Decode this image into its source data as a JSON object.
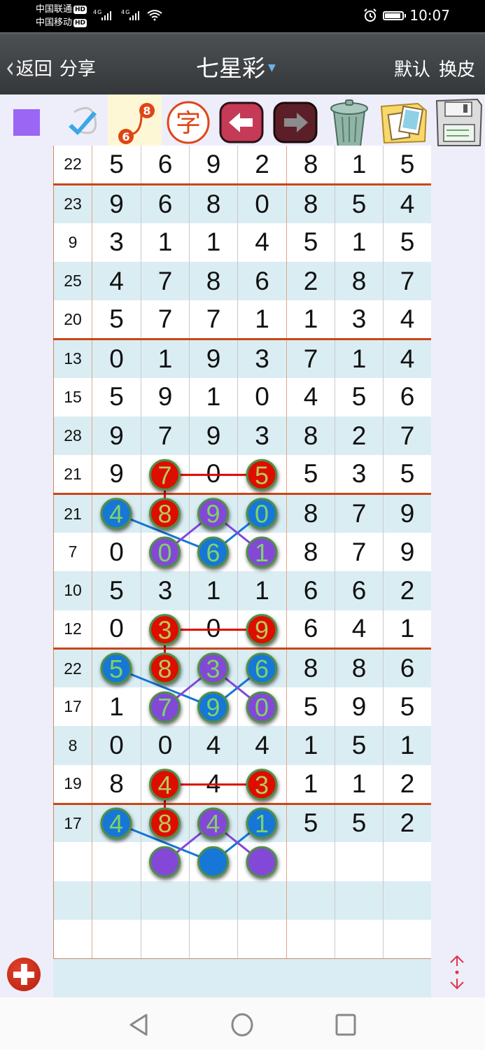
{
  "status_bar": {
    "carrier1": "中国联通",
    "carrier2": "中国移动",
    "hd_badge": "HD",
    "signal1": "4G",
    "signal2": "4G",
    "time": "10:07",
    "icons": [
      "alarm-icon",
      "battery-icon",
      "wifi-icon",
      "signal-icon"
    ]
  },
  "navbar": {
    "back_label": "返回",
    "share_label": "分享",
    "title": "七星彩",
    "default_label": "默认",
    "skin_label": "换皮"
  },
  "toolbar": {
    "items": [
      {
        "name": "color-swatch",
        "color": "#9b66f4"
      },
      {
        "name": "check-icon"
      },
      {
        "name": "connect-numbers-icon",
        "top_num": "8",
        "bottom_num": "6",
        "selected": true
      },
      {
        "name": "text-icon",
        "label": "字"
      },
      {
        "name": "undo-arrow-icon"
      },
      {
        "name": "redo-arrow-icon"
      },
      {
        "name": "trash-icon"
      },
      {
        "name": "photos-icon"
      },
      {
        "name": "save-icon"
      }
    ]
  },
  "grid": {
    "rows": [
      {
        "idx": "22",
        "nums": [
          "5",
          "6",
          "9",
          "2",
          "8",
          "1",
          "5"
        ],
        "sep": true
      },
      {
        "idx": "23",
        "nums": [
          "9",
          "6",
          "8",
          "0",
          "8",
          "5",
          "4"
        ]
      },
      {
        "idx": "9",
        "nums": [
          "3",
          "1",
          "1",
          "4",
          "5",
          "1",
          "5"
        ]
      },
      {
        "idx": "25",
        "nums": [
          "4",
          "7",
          "8",
          "6",
          "2",
          "8",
          "7"
        ]
      },
      {
        "idx": "20",
        "nums": [
          "5",
          "7",
          "7",
          "1",
          "1",
          "3",
          "4"
        ],
        "sep": true
      },
      {
        "idx": "13",
        "nums": [
          "0",
          "1",
          "9",
          "3",
          "7",
          "1",
          "4"
        ]
      },
      {
        "idx": "15",
        "nums": [
          "5",
          "9",
          "1",
          "0",
          "4",
          "5",
          "6"
        ]
      },
      {
        "idx": "28",
        "nums": [
          "9",
          "7",
          "9",
          "3",
          "8",
          "2",
          "7"
        ]
      },
      {
        "idx": "21",
        "nums": [
          "9",
          "7",
          "0",
          "5",
          "5",
          "3",
          "5"
        ],
        "sep": true
      },
      {
        "idx": "21",
        "nums": [
          "4",
          "8",
          "9",
          "0",
          "8",
          "7",
          "9"
        ]
      },
      {
        "idx": "7",
        "nums": [
          "0",
          "0",
          "6",
          "1",
          "8",
          "7",
          "9"
        ]
      },
      {
        "idx": "10",
        "nums": [
          "5",
          "3",
          "1",
          "1",
          "6",
          "6",
          "2"
        ]
      },
      {
        "idx": "12",
        "nums": [
          "0",
          "3",
          "0",
          "9",
          "6",
          "4",
          "1"
        ],
        "sep": true
      },
      {
        "idx": "22",
        "nums": [
          "5",
          "8",
          "3",
          "6",
          "8",
          "8",
          "6"
        ]
      },
      {
        "idx": "17",
        "nums": [
          "1",
          "7",
          "9",
          "0",
          "5",
          "9",
          "5"
        ]
      },
      {
        "idx": "8",
        "nums": [
          "0",
          "0",
          "4",
          "4",
          "1",
          "5",
          "1"
        ]
      },
      {
        "idx": "19",
        "nums": [
          "8",
          "4",
          "4",
          "3",
          "1",
          "1",
          "2"
        ],
        "sep": true
      },
      {
        "idx": "17",
        "nums": [
          "4",
          "8",
          "4",
          "1",
          "5",
          "5",
          "2"
        ]
      },
      {
        "idx": "",
        "nums": [
          "",
          "",
          "",
          "",
          "",
          "",
          ""
        ]
      },
      {
        "idx": "",
        "nums": [
          "",
          "",
          "",
          "",
          "",
          "",
          ""
        ]
      },
      {
        "idx": "",
        "nums": [
          "",
          "",
          "",
          "",
          "",
          "",
          ""
        ]
      }
    ],
    "colors": {
      "red": "#dd0a00",
      "blue": "#1377d6",
      "purple": "#8348d6",
      "ring": "#4f8f47",
      "num_text": "#7ed36a"
    },
    "marks": [
      {
        "row": 8,
        "col": 1,
        "color": "red",
        "text": "7"
      },
      {
        "row": 8,
        "col": 3,
        "color": "red",
        "text": "5"
      },
      {
        "row": 9,
        "col": 0,
        "color": "blue",
        "text": "4"
      },
      {
        "row": 9,
        "col": 1,
        "color": "red",
        "text": "8"
      },
      {
        "row": 9,
        "col": 2,
        "color": "purple",
        "text": "9"
      },
      {
        "row": 9,
        "col": 3,
        "color": "blue",
        "text": "0"
      },
      {
        "row": 10,
        "col": 1,
        "color": "purple",
        "text": "0"
      },
      {
        "row": 10,
        "col": 2,
        "color": "blue",
        "text": "6"
      },
      {
        "row": 10,
        "col": 3,
        "color": "purple",
        "text": "1"
      },
      {
        "row": 12,
        "col": 1,
        "color": "red",
        "text": "3"
      },
      {
        "row": 12,
        "col": 3,
        "color": "red",
        "text": "9"
      },
      {
        "row": 13,
        "col": 0,
        "color": "blue",
        "text": "5"
      },
      {
        "row": 13,
        "col": 1,
        "color": "red",
        "text": "8"
      },
      {
        "row": 13,
        "col": 2,
        "color": "purple",
        "text": "3"
      },
      {
        "row": 13,
        "col": 3,
        "color": "blue",
        "text": "6"
      },
      {
        "row": 14,
        "col": 1,
        "color": "purple",
        "text": "7"
      },
      {
        "row": 14,
        "col": 2,
        "color": "blue",
        "text": "9"
      },
      {
        "row": 14,
        "col": 3,
        "color": "purple",
        "text": "0"
      },
      {
        "row": 16,
        "col": 1,
        "color": "red",
        "text": "4"
      },
      {
        "row": 16,
        "col": 3,
        "color": "red",
        "text": "3"
      },
      {
        "row": 17,
        "col": 0,
        "color": "blue",
        "text": "4"
      },
      {
        "row": 17,
        "col": 1,
        "color": "red",
        "text": "8"
      },
      {
        "row": 17,
        "col": 2,
        "color": "purple",
        "text": "4"
      },
      {
        "row": 17,
        "col": 3,
        "color": "blue",
        "text": "1"
      },
      {
        "row": 18,
        "col": 1,
        "color": "purple",
        "text": ""
      },
      {
        "row": 18,
        "col": 2,
        "color": "blue",
        "text": ""
      },
      {
        "row": 18,
        "col": 3,
        "color": "purple",
        "text": ""
      }
    ],
    "links": [
      {
        "from": [
          8,
          1
        ],
        "to": [
          8,
          3
        ],
        "color": "red"
      },
      {
        "from": [
          8,
          1
        ],
        "to": [
          9,
          1
        ],
        "color": "red"
      },
      {
        "from": [
          9,
          0
        ],
        "to": [
          10,
          2
        ],
        "color": "blue"
      },
      {
        "from": [
          9,
          3
        ],
        "to": [
          10,
          2
        ],
        "color": "blue"
      },
      {
        "from": [
          9,
          2
        ],
        "to": [
          10,
          1
        ],
        "color": "purple"
      },
      {
        "from": [
          9,
          2
        ],
        "to": [
          10,
          3
        ],
        "color": "purple"
      },
      {
        "from": [
          12,
          1
        ],
        "to": [
          12,
          3
        ],
        "color": "red"
      },
      {
        "from": [
          12,
          1
        ],
        "to": [
          13,
          1
        ],
        "color": "red"
      },
      {
        "from": [
          13,
          0
        ],
        "to": [
          14,
          2
        ],
        "color": "blue"
      },
      {
        "from": [
          13,
          3
        ],
        "to": [
          14,
          2
        ],
        "color": "blue"
      },
      {
        "from": [
          13,
          2
        ],
        "to": [
          14,
          1
        ],
        "color": "purple"
      },
      {
        "from": [
          13,
          2
        ],
        "to": [
          14,
          3
        ],
        "color": "purple"
      },
      {
        "from": [
          16,
          1
        ],
        "to": [
          16,
          3
        ],
        "color": "red"
      },
      {
        "from": [
          16,
          1
        ],
        "to": [
          17,
          1
        ],
        "color": "red"
      },
      {
        "from": [
          17,
          0
        ],
        "to": [
          18,
          2
        ],
        "color": "blue"
      },
      {
        "from": [
          17,
          3
        ],
        "to": [
          18,
          2
        ],
        "color": "blue"
      },
      {
        "from": [
          17,
          2
        ],
        "to": [
          18,
          1
        ],
        "color": "purple"
      },
      {
        "from": [
          17,
          2
        ],
        "to": [
          18,
          3
        ],
        "color": "purple"
      }
    ]
  },
  "bottom": {
    "add_button": "add-icon",
    "scroll_toggle": "scroll-up-down-icon"
  },
  "system_nav": [
    "back",
    "home",
    "recents"
  ]
}
